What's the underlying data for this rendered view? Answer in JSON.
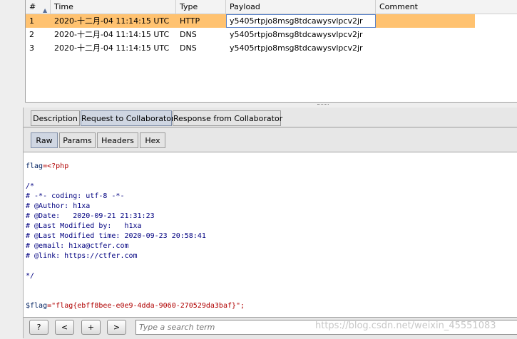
{
  "table": {
    "columns": [
      "#",
      "Time",
      "Type",
      "Payload",
      "Comment"
    ],
    "sort_arrow": "▲",
    "rows": [
      {
        "num": "1",
        "time": "2020-十二月-04 11:14:15 UTC",
        "type": "HTTP",
        "payload": "y5405rtpjo8msg8tdcawysvlpcv2jr",
        "comment": ""
      },
      {
        "num": "2",
        "time": "2020-十二月-04 11:14:15 UTC",
        "type": "DNS",
        "payload": "y5405rtpjo8msg8tdcawysvlpcv2jr",
        "comment": ""
      },
      {
        "num": "3",
        "time": "2020-十二月-04 11:14:15 UTC",
        "type": "DNS",
        "payload": "y5405rtpjo8msg8tdcawysvlpcv2jr",
        "comment": ""
      }
    ],
    "selected_row_color": "#ffc270"
  },
  "tabs": [
    "Description",
    "Request to Collaborator",
    "Response from Collaborator"
  ],
  "subtabs": [
    "Raw",
    "Params",
    "Headers",
    "Hex"
  ],
  "code": {
    "l1a": "flag",
    "l1b": "=<?php",
    "l2": "/*",
    "l3": "# -*- coding: utf-8 -*-",
    "l4": "# @Author: h1xa",
    "l5": "# @Date:   2020-09-21 21:31:23",
    "l6": "# @Last Modified by:   h1xa",
    "l7": "# @Last Modified time: 2020-09-23 20:58:41",
    "l8": "# @email: h1xa@ctfer.com",
    "l9": "# @link: https://ctfer.com",
    "l10": "*/",
    "l11a": "$flag",
    "l11b": "=\"flag{ebff8bee-e0e9-4dda-9060-270529da3baf}\";"
  },
  "bottom": {
    "help": "?",
    "prev": "<",
    "add": "+",
    "next": ">",
    "search_placeholder": "Type a search term"
  },
  "watermark": "https://blog.csdn.net/weixin_45551083"
}
